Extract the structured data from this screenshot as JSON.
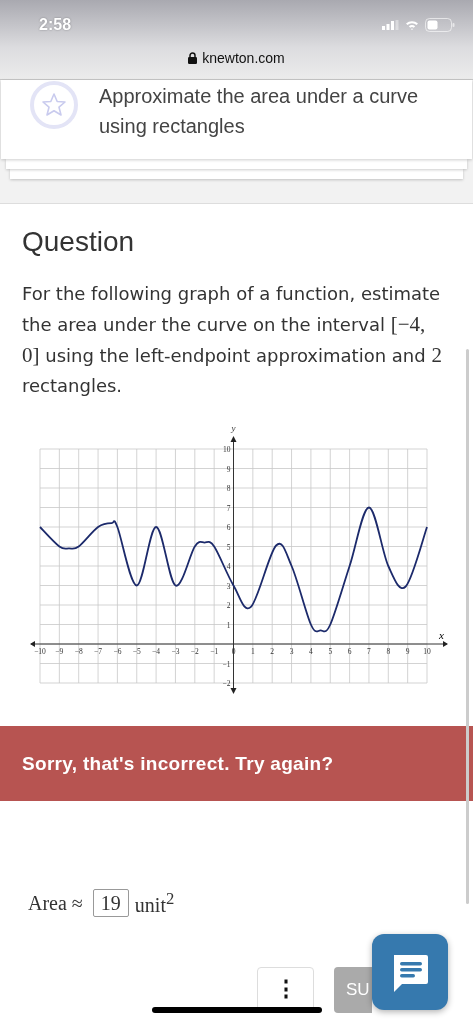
{
  "status_bar": {
    "time": "2:58"
  },
  "address_bar": {
    "url": "knewton.com"
  },
  "lesson_card": {
    "title": "Approximate the area under a curve using rectangles"
  },
  "question": {
    "heading": "Question",
    "text": [
      {
        "kind": "text",
        "text": "For the following graph of a function, estimate the area under the curve on the interval "
      },
      {
        "kind": "math",
        "text": "[−4, 0]"
      },
      {
        "kind": "text",
        "text": " using the left-endpoint approximation and "
      },
      {
        "kind": "math",
        "text": "2"
      },
      {
        "kind": "text",
        "text": " rectangles."
      }
    ],
    "chart_data": {
      "type": "line",
      "grid": true,
      "xlabel": "x",
      "ylabel": "y",
      "xlim": [
        -10,
        10
      ],
      "ylim": [
        -2,
        10
      ],
      "xticks": [
        -10,
        -9,
        -8,
        -7,
        -6,
        -5,
        -4,
        -3,
        -2,
        -1,
        0,
        1,
        2,
        3,
        4,
        5,
        6,
        7,
        8,
        9,
        10
      ],
      "yticks": [
        -2,
        -1,
        1,
        2,
        3,
        4,
        5,
        6,
        7,
        8,
        9,
        10
      ],
      "x": [
        -10,
        -9,
        -8.5,
        -8,
        -7,
        -6.3,
        -6,
        -5,
        -4,
        -3,
        -2,
        -1.5,
        -1,
        0,
        0.9,
        2.2,
        3,
        4,
        4.5,
        5,
        6,
        7,
        8,
        8.9,
        10
      ],
      "series": [
        {
          "color": "#1c2a6b",
          "values": [
            6,
            5,
            4.9,
            5,
            6,
            6.2,
            6,
            3,
            6,
            3,
            5,
            5.2,
            5,
            3,
            1.9,
            5.05,
            4,
            1,
            0.7,
            1,
            4,
            7,
            4,
            2.95,
            6
          ]
        }
      ]
    }
  },
  "feedback": {
    "message": "Sorry, that's incorrect. Try again?"
  },
  "answer": {
    "label": "Area ≈",
    "value": "19",
    "unit": "unit$^{2}$"
  },
  "actions": {
    "more": "⋮",
    "submit": "SU"
  }
}
